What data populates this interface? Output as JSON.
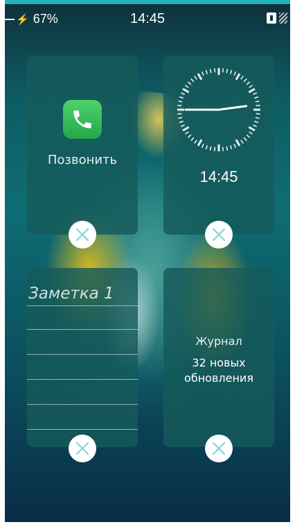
{
  "status_bar": {
    "battery_percent": "67%",
    "time": "14:45",
    "icons": [
      "charging-icon",
      "sim-icon",
      "signal-icon"
    ]
  },
  "widgets": {
    "call": {
      "label": "Позвонить",
      "icon": "phone-icon"
    },
    "clock": {
      "time": "14:45"
    },
    "note": {
      "title": "Заметка 1"
    },
    "journal": {
      "title": "Журнал",
      "updates": "32 новых обновления"
    }
  },
  "colors": {
    "accent_bar": "#23b2b6",
    "close_button_x": "#7fd6d3",
    "call_icon_green": "#34c759"
  }
}
